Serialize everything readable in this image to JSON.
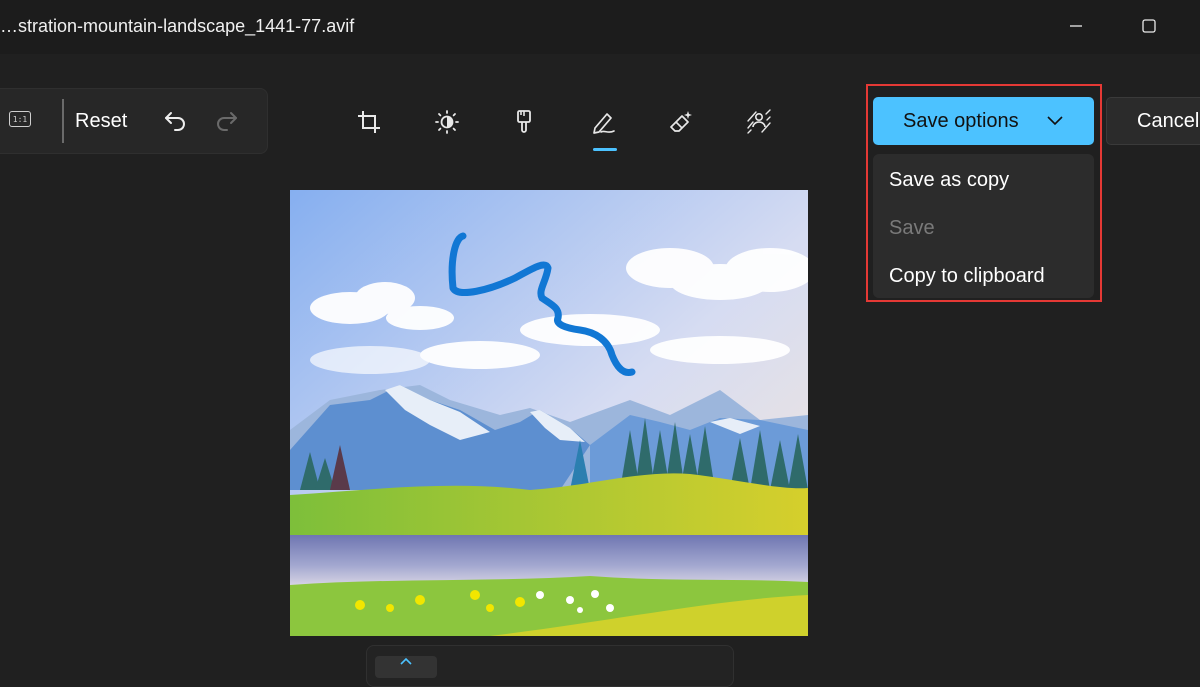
{
  "window": {
    "title": "…stration-mountain-landscape_1441-77.avif",
    "minimize_icon": "minimize-icon",
    "maximize_icon": "maximize-icon"
  },
  "toolbar_left": {
    "aspect_ratio_label": "1:1",
    "reset_label": "Reset",
    "undo_icon": "undo-icon",
    "redo_icon": "redo-icon"
  },
  "tools": [
    {
      "name": "crop",
      "icon": "crop-icon"
    },
    {
      "name": "adjustment",
      "icon": "brightness-icon"
    },
    {
      "name": "filter",
      "icon": "paintbrush-icon"
    },
    {
      "name": "markup",
      "icon": "pen-icon",
      "selected": true
    },
    {
      "name": "erase",
      "icon": "magic-erase-icon"
    },
    {
      "name": "background",
      "icon": "background-blur-icon"
    }
  ],
  "save": {
    "label": "Save options",
    "menu": [
      {
        "label": "Save as copy",
        "enabled": true
      },
      {
        "label": "Save",
        "enabled": false
      },
      {
        "label": "Copy to clipboard",
        "enabled": true
      }
    ]
  },
  "cancel": {
    "label": "Cancel"
  },
  "colors": {
    "accent": "#4cc2ff",
    "background": "#202020",
    "highlight": "#e53935",
    "ink": "#1177d4"
  }
}
